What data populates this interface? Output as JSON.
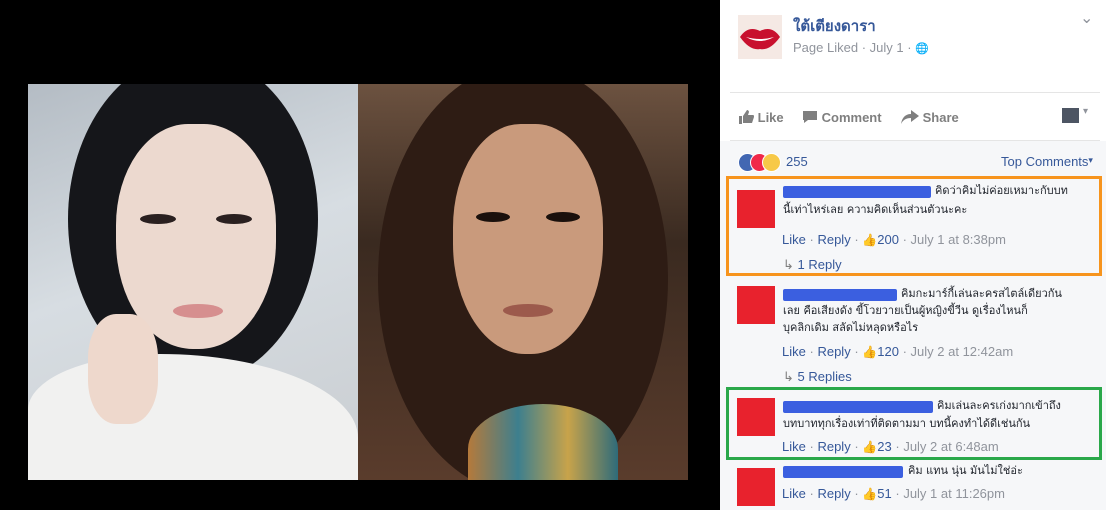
{
  "post": {
    "page_name": "ใต้เตียงดารา",
    "subtitle_liked": "Page Liked",
    "subtitle_sep": "·",
    "subtitle_date": "July 1",
    "subtitle_globe": "🌐",
    "menu_chevron": "⌄"
  },
  "actions": {
    "like": "Like",
    "comment": "Comment",
    "share": "Share"
  },
  "reactions": {
    "count": "255",
    "sort_label": "Top Comments",
    "sort_chevron": "▾"
  },
  "comments": [
    {
      "text_line1": "คิดว่าคิมไม่ค่อยเหมาะกับบท",
      "text_line2": "นี้เท่าไหร่เลย ความคิดเห็นส่วนตัวนะคะ",
      "text_line3": "",
      "like": "Like",
      "reply": "Reply",
      "likes": "200",
      "time": "July 1 at 8:38pm",
      "replies": "1 Reply"
    },
    {
      "text_line1": "คิมกะมาร์กี้เล่นละครสไตล์เดียวกัน",
      "text_line2": "เลย คือเสียงดัง ขี้โวยวายเป็นผู้หญิงขี้วีน ดูเรื่องไหนก็",
      "text_line3": "บุคลิกเดิม สลัดไม่หลุดหรือไร",
      "like": "Like",
      "reply": "Reply",
      "likes": "120",
      "time": "July 2 at 12:42am",
      "replies": "5 Replies"
    },
    {
      "text_line1": "คิมเล่นละครเก่งมากเข้าถึง",
      "text_line2": "บทบาททุกเรื่องเท่าที่ติดตามมา บทนี้คงทำได้ดีเช่นกัน",
      "text_line3": "",
      "like": "Like",
      "reply": "Reply",
      "likes": "23",
      "time": "July 2 at 6:48am",
      "replies": ""
    },
    {
      "text_line1": "คิม แทน นุ่น มันไม่ใช่อ่ะ",
      "text_line2": "",
      "text_line3": "",
      "like": "Like",
      "reply": "Reply",
      "likes": "51",
      "time": "July 1 at 11:26pm",
      "replies": ""
    }
  ],
  "icons": {
    "thumb": "👍",
    "dot": "·"
  },
  "colors": {
    "link": "#365899",
    "muted": "#90949c",
    "avatar_red": "#e8222d",
    "redaction_blue": "#3b5fe0",
    "highlight_orange": "#f7941d",
    "highlight_green": "#2aa84a"
  }
}
